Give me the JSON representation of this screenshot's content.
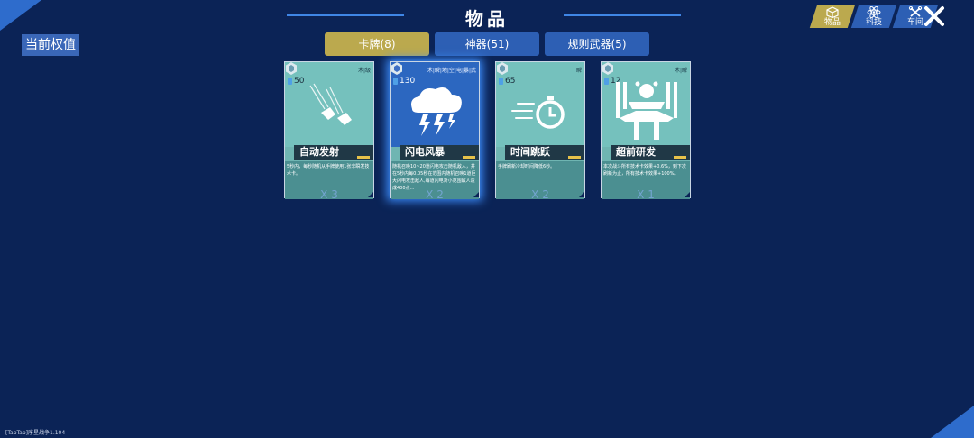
{
  "header": {
    "title": "物品",
    "current_value_label": "当前权值"
  },
  "nav": [
    {
      "label": "物品",
      "icon": "cube-icon",
      "active": true
    },
    {
      "label": "科技",
      "icon": "atom-icon",
      "active": false
    },
    {
      "label": "车间",
      "icon": "wrench-icon",
      "active": false
    }
  ],
  "tabs": [
    {
      "label": "卡牌(8)",
      "active": true
    },
    {
      "label": "神器(51)",
      "active": false
    },
    {
      "label": "规则武器(5)",
      "active": false
    }
  ],
  "cards": [
    {
      "name": "自动发射",
      "cost": "50",
      "tags": "术|级",
      "desc": "5秒内，每秒随机从手牌使用1张非瞬发技术卡。",
      "count": "X 3",
      "art": "bullets-icon"
    },
    {
      "name": "闪电风暴",
      "cost": "130",
      "tags": "术|瞬|地|空|电|暴|武",
      "desc": "随机召唤10~20道闪电攻击随机敌人，并在5秒内每0.05秒在范围内随机召唤1道巨大闪电攻击敌人,每道闪电对小范围敌人造成400点…",
      "count": "X 2",
      "art": "lightning-cloud-icon"
    },
    {
      "name": "时间跳跃",
      "cost": "65",
      "tags": "瞬",
      "desc": "手牌刷新冷却时间降低6秒。",
      "count": "X 2",
      "art": "stopwatch-icon"
    },
    {
      "name": "超前研发",
      "cost": "12",
      "tags": "术|瞬",
      "desc": "本次战斗所有技术卡效果+0.6%，到下次刷新为止，所有技术卡效果+100%。",
      "count": "X 1",
      "art": "research-icon"
    }
  ],
  "footer": {
    "version": "[TapTap]序星战争1.104"
  },
  "colors": {
    "background": "#0b2356",
    "accent_gold": "#bba94e",
    "accent_blue": "#2d5fb4"
  }
}
